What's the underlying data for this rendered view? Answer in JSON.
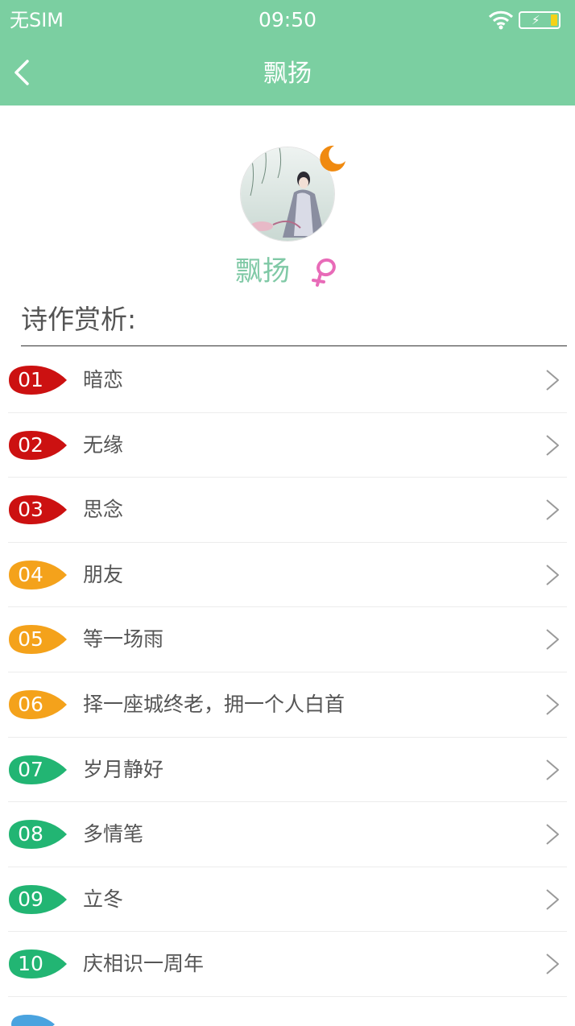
{
  "status_bar": {
    "carrier": "无SIM",
    "time": "09:50",
    "battery_color": "#f5d218"
  },
  "nav": {
    "title": "飘扬",
    "back_icon": "chevron-left-icon",
    "background": "#7bcfa1"
  },
  "profile": {
    "name": "飘扬",
    "avatar_icon": "avatar",
    "badge_icon": "moon-icon",
    "gender_icon": "female-icon",
    "name_color": "#80c9a6"
  },
  "section": {
    "title": "诗作赏析:"
  },
  "items": [
    {
      "num": "01",
      "title": "暗恋",
      "color": "#cc1111"
    },
    {
      "num": "02",
      "title": "无缘",
      "color": "#cc1111"
    },
    {
      "num": "03",
      "title": "思念",
      "color": "#cc1111"
    },
    {
      "num": "04",
      "title": "朋友",
      "color": "#f4a21b"
    },
    {
      "num": "05",
      "title": "等一场雨",
      "color": "#f4a21b"
    },
    {
      "num": "06",
      "title": "择一座城终老，拥一个人白首",
      "color": "#f4a21b"
    },
    {
      "num": "07",
      "title": "岁月静好",
      "color": "#22b573"
    },
    {
      "num": "08",
      "title": "多情笔",
      "color": "#22b573"
    },
    {
      "num": "09",
      "title": "立冬",
      "color": "#22b573"
    },
    {
      "num": "10",
      "title": "庆相识一周年",
      "color": "#22b573"
    }
  ],
  "next_badge_color": "#4aa3df"
}
